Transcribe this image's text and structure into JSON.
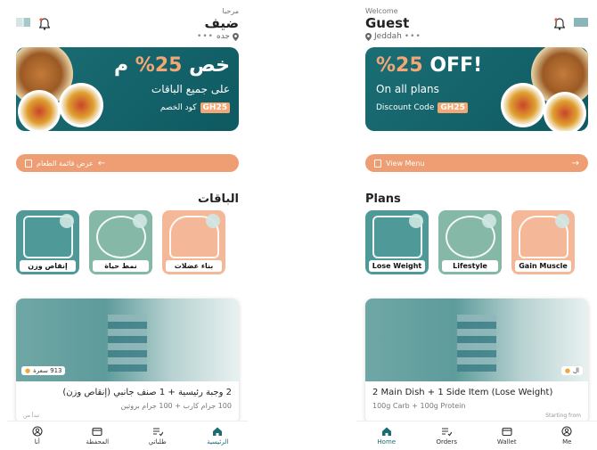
{
  "screens": {
    "ar": {
      "header": {
        "welcome": "مرحبا",
        "name": "ضيف",
        "location": "جده",
        "dots": "•••"
      },
      "banner": {
        "title_prefix": "خص",
        "title_pct": "25%",
        "title_suffix": "م",
        "subtitle": "على جميع الباقات",
        "code_label": "كود الخصم",
        "code": "GH25"
      },
      "menu_button": "عرض قائمة الطعام",
      "plans_title": "الباقات",
      "plans": [
        {
          "label": "إنقاص وزن"
        },
        {
          "label": "نمط حياة"
        },
        {
          "label": "بناء عضلات"
        }
      ],
      "meal": {
        "calories": "913 سعرة",
        "title": "2 وجبة رئيسية + 1 صنف جانبي (إنقاص وزن)",
        "subtitle": "100 جرام كارب + 100 جرام بروتين",
        "starting": "تبدأ من"
      },
      "nav": [
        {
          "label": "الرئيسية",
          "icon": "home-icon",
          "active": true
        },
        {
          "label": "طلباتي",
          "icon": "orders-icon",
          "active": false
        },
        {
          "label": "المحفظة",
          "icon": "wallet-icon",
          "active": false
        },
        {
          "label": "أنا",
          "icon": "profile-icon",
          "active": false
        }
      ]
    },
    "en": {
      "header": {
        "welcome": "Welcome",
        "name": "Guest",
        "location": "Jeddah",
        "dots": "•••"
      },
      "banner": {
        "title_pct": "%25",
        "title_suffix": "OFF!",
        "subtitle": "On all plans",
        "code_label": "Discount Code",
        "code": "GH25"
      },
      "menu_button": "View Menu",
      "plans_title": "Plans",
      "plans": [
        {
          "label": "Lose Weight"
        },
        {
          "label": "Lifestyle"
        },
        {
          "label": "Gain Muscle"
        }
      ],
      "meal": {
        "calories": "ال",
        "title": "2 Main Dish + 1 Side Item (Lose Weight)",
        "subtitle": "100g Carb + 100g Protein",
        "starting": "Starting from"
      },
      "nav": [
        {
          "label": "Home",
          "icon": "home-icon",
          "active": true
        },
        {
          "label": "Orders",
          "icon": "orders-icon",
          "active": false
        },
        {
          "label": "Wallet",
          "icon": "wallet-icon",
          "active": false
        },
        {
          "label": "Me",
          "icon": "profile-icon",
          "active": false
        }
      ]
    }
  },
  "colors": {
    "teal": "#1a6e74",
    "accent": "#ef9d72",
    "peach": "#f4b898",
    "sage": "#86b8a7"
  }
}
